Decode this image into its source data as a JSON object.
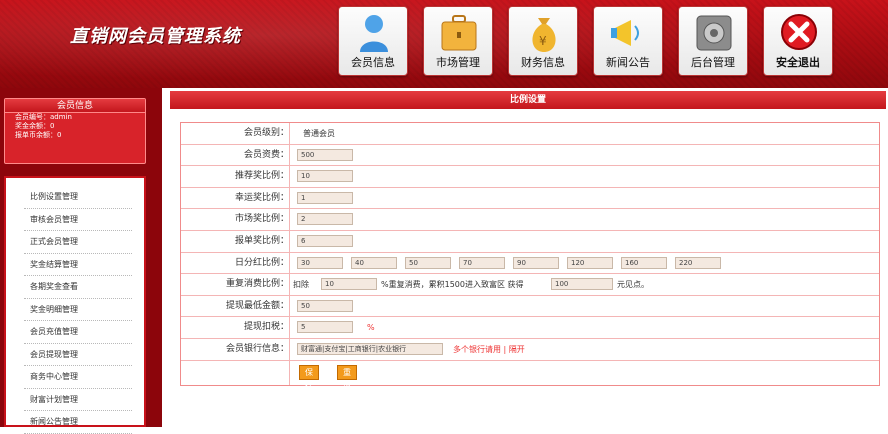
{
  "app": {
    "title": "直销网会员管理系统"
  },
  "nav": [
    {
      "label": "会员信息",
      "icon": "person-icon"
    },
    {
      "label": "市场管理",
      "icon": "briefcase-icon"
    },
    {
      "label": "财务信息",
      "icon": "money-bag-icon"
    },
    {
      "label": "新闻公告",
      "icon": "megaphone-icon"
    },
    {
      "label": "后台管理",
      "icon": "safe-icon"
    },
    {
      "label": "安全退出",
      "icon": "close-icon"
    }
  ],
  "member": {
    "header": "会员信息",
    "id_label": "会员编号：",
    "id_value": "admin",
    "cash_label": "奖金余额：",
    "cash_value": "0",
    "report_label": "报单币余额：",
    "report_value": "0"
  },
  "menu": [
    "比例设置管理",
    "审核会员管理",
    "正式会员管理",
    "奖金结算管理",
    "各期奖金查看",
    "奖金明细管理",
    "会员充值管理",
    "会员提现管理",
    "商务中心管理",
    "财富计划管理",
    "新闻公告管理"
  ],
  "main": {
    "header": "比例设置",
    "fields": {
      "level": {
        "label": "会员级别：",
        "value": "普通会员"
      },
      "fee": {
        "label": "会员资费：",
        "value": "500"
      },
      "recommend": {
        "label": "推荐奖比例：",
        "value": "10"
      },
      "lucky": {
        "label": "幸运奖比例：",
        "value": "1"
      },
      "market": {
        "label": "市场奖比例：",
        "value": "2"
      },
      "report": {
        "label": "报单奖比例：",
        "value": "6"
      },
      "dividend": {
        "label": "日分红比例：",
        "values": [
          "30",
          "40",
          "50",
          "70",
          "90",
          "120",
          "160",
          "220"
        ]
      },
      "repeat": {
        "label": "重复消费比例：",
        "prefix": "扣除",
        "value": "10",
        "text1": "%重复消费，累积1500进入致富区 获得",
        "value2": "100",
        "text2": "元见点。"
      },
      "min_withdraw": {
        "label": "提现最低金额：",
        "value": "50"
      },
      "withdraw_tax": {
        "label": "提现扣税：",
        "value": "5",
        "unit": "%"
      },
      "bank": {
        "label": "会员银行信息：",
        "value": "财富通|支付宝|工商银行|农业银行",
        "note": "多个银行请用 | 隔开"
      }
    },
    "buttons": {
      "save": "保存",
      "reset": "重填"
    }
  }
}
